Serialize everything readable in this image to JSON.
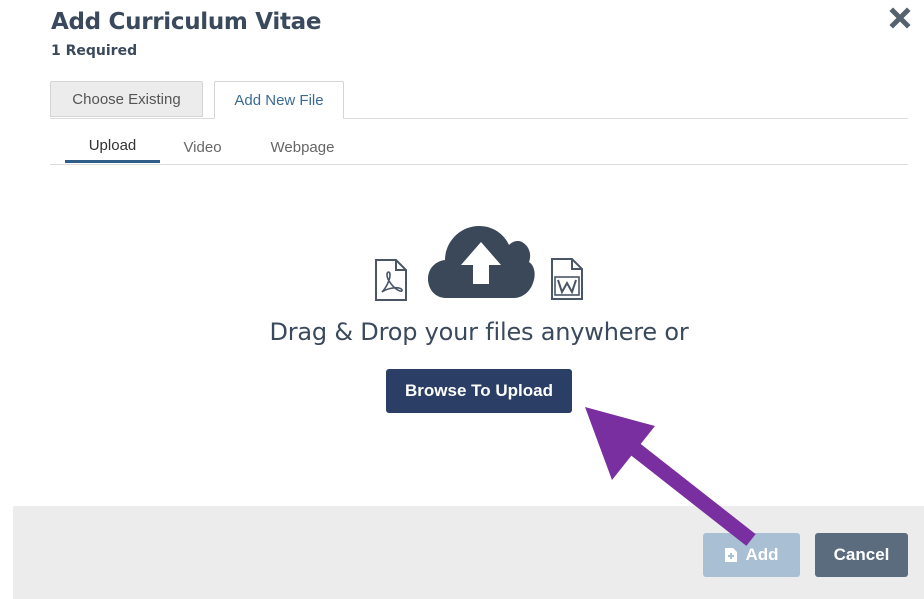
{
  "dialog": {
    "title": "Add Curriculum Vitae",
    "subtitle": "1 Required",
    "close_icon": "close-x-icon"
  },
  "tabs": [
    {
      "label": "Choose Existing",
      "active": false
    },
    {
      "label": "Add New File",
      "active": true
    }
  ],
  "subtabs": [
    {
      "label": "Upload",
      "active": true
    },
    {
      "label": "Video",
      "active": false
    },
    {
      "label": "Webpage",
      "active": false
    }
  ],
  "dropzone": {
    "text": "Drag & Drop your files anywhere or",
    "browse_label": "Browse To Upload",
    "icons": [
      "pdf-file-icon",
      "cloud-upload-icon",
      "word-file-icon"
    ]
  },
  "footer": {
    "add_label": "Add",
    "cancel_label": "Cancel"
  },
  "colors": {
    "primary": "#2b3f66",
    "disabled_add": "#a9bfd4",
    "cancel": "#5b6c7e",
    "annotation_arrow": "#7a2fa0"
  }
}
